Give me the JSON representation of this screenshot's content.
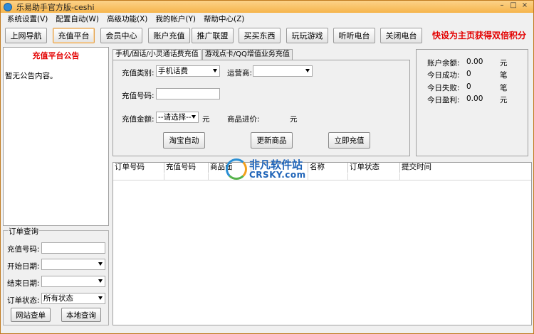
{
  "window": {
    "title": "乐易助手官方版-ceshi",
    "controls": {
      "minimize": "–",
      "maximize": "□",
      "close": "×"
    }
  },
  "menu": [
    "系统设置(V)",
    "配置自动(W)",
    "高级功能(X)",
    "我的帐户(Y)",
    "帮助中心(Z)"
  ],
  "toolbar": {
    "buttons": [
      "上网导航",
      "充值平台",
      "会员中心",
      "账户充值",
      "推广联盟",
      "买买东西",
      "玩玩游戏",
      "听听电台",
      "关闭电台"
    ],
    "active_index": 1,
    "promo": "快设为主页获得双倍积分"
  },
  "notice": {
    "title": "充值平台公告",
    "body": "暂无公告内容。"
  },
  "order_query": {
    "legend": "订单查询",
    "fields": {
      "order_no_label": "充值号码:",
      "start_date_label": "开始日期:",
      "end_date_label": "结束日期:",
      "status_label": "订单状态:",
      "status_value": "所有状态"
    },
    "buttons": {
      "web_query": "网站查单",
      "local_query": "本地查询"
    }
  },
  "tabs": [
    "手机/固话/小灵通话费充值",
    "游戏点卡/QQ增值业务充值"
  ],
  "recharge_form": {
    "category_label": "充值类别:",
    "category_value": "手机话费",
    "operator_label": "运营商:",
    "operator_value": "",
    "number_label": "充值号码:",
    "amount_label": "充值金额:",
    "amount_value": "--请选择--",
    "amount_unit": "元",
    "price_label": "商品进价:",
    "price_unit": "元",
    "buttons": {
      "taobao_auto": "淘宝自动",
      "update_goods": "更新商品",
      "recharge_now": "立即充值"
    }
  },
  "stats": [
    {
      "label": "账户余额:",
      "value": "0.00",
      "unit": "元"
    },
    {
      "label": "今日成功:",
      "value": "0",
      "unit": "笔"
    },
    {
      "label": "今日失败:",
      "value": "0",
      "unit": "笔"
    },
    {
      "label": "今日盈利:",
      "value": "0.00",
      "unit": "元"
    }
  ],
  "orders_table": {
    "columns": [
      "订单号码",
      "充值号码",
      "商品面",
      "",
      "名称",
      "订单状态",
      "提交时间"
    ]
  },
  "watermark": {
    "cn": "非凡软件站",
    "en": "CRSKY.com"
  },
  "colors": {
    "accent_orange": "#f6b54c",
    "promo_red": "#e30000",
    "watermark_blue": "#1f64b8"
  }
}
